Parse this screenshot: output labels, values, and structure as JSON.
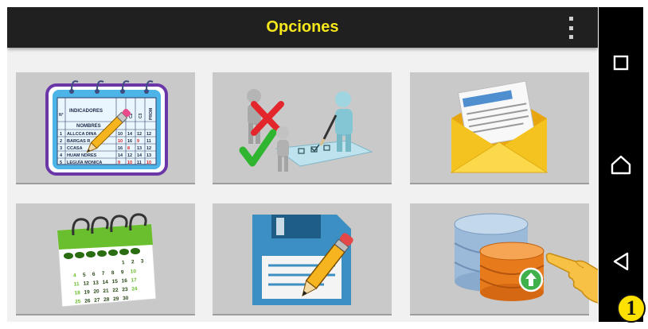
{
  "appbar": {
    "title": "Opciones"
  },
  "grade_sheet": {
    "header_no": "N°",
    "header_indicadores": "INDICADORES",
    "header_nombres": "NOMBRES",
    "col_headers": [
      "C1",
      "C2",
      "C3",
      "PROM"
    ],
    "rows": [
      {
        "num": "1",
        "name": "ALLCCA DINA",
        "grades": [
          "10",
          "14",
          "12",
          "12"
        ]
      },
      {
        "num": "2",
        "name": "BARGAS R",
        "grades": [
          "10",
          "16",
          "9",
          "11"
        ]
      },
      {
        "num": "3",
        "name": "CCASA",
        "grades": [
          "16",
          "8",
          "13",
          "12"
        ]
      },
      {
        "num": "4",
        "name": "HUAM NDRES",
        "grades": [
          "14",
          "12",
          "14",
          "13"
        ]
      },
      {
        "num": "5",
        "name": "LEGUÍA MONICA",
        "grades": [
          "9",
          "10",
          "11",
          "10"
        ]
      }
    ]
  },
  "calendar": {
    "days": [
      "1",
      "2",
      "3",
      "4",
      "5",
      "6",
      "7",
      "8",
      "9",
      "10",
      "11",
      "12",
      "13",
      "14",
      "15",
      "16",
      "17",
      "18",
      "19",
      "20",
      "21",
      "22",
      "23",
      "24",
      "25",
      "26",
      "27",
      "28",
      "29",
      "30"
    ]
  },
  "badge": {
    "number": "1"
  },
  "colors": {
    "appbar_bg": "#202020",
    "title": "#f5e71c",
    "tile_bg": "#c9c9c9",
    "badge": "#ffe100"
  },
  "icons": {
    "grade_sheet": "grade-sheet-icon",
    "evaluation": "evaluation-figures-icon",
    "mail": "envelope-document-icon",
    "calendar": "calendar-icon",
    "save": "floppy-pencil-icon",
    "database_upload": "database-upload-icon",
    "pointer": "pointing-hand-icon",
    "menu": "overflow-menu-icon",
    "nav_recents": "recents-square-icon",
    "nav_home": "home-icon",
    "nav_back": "back-triangle-icon"
  }
}
